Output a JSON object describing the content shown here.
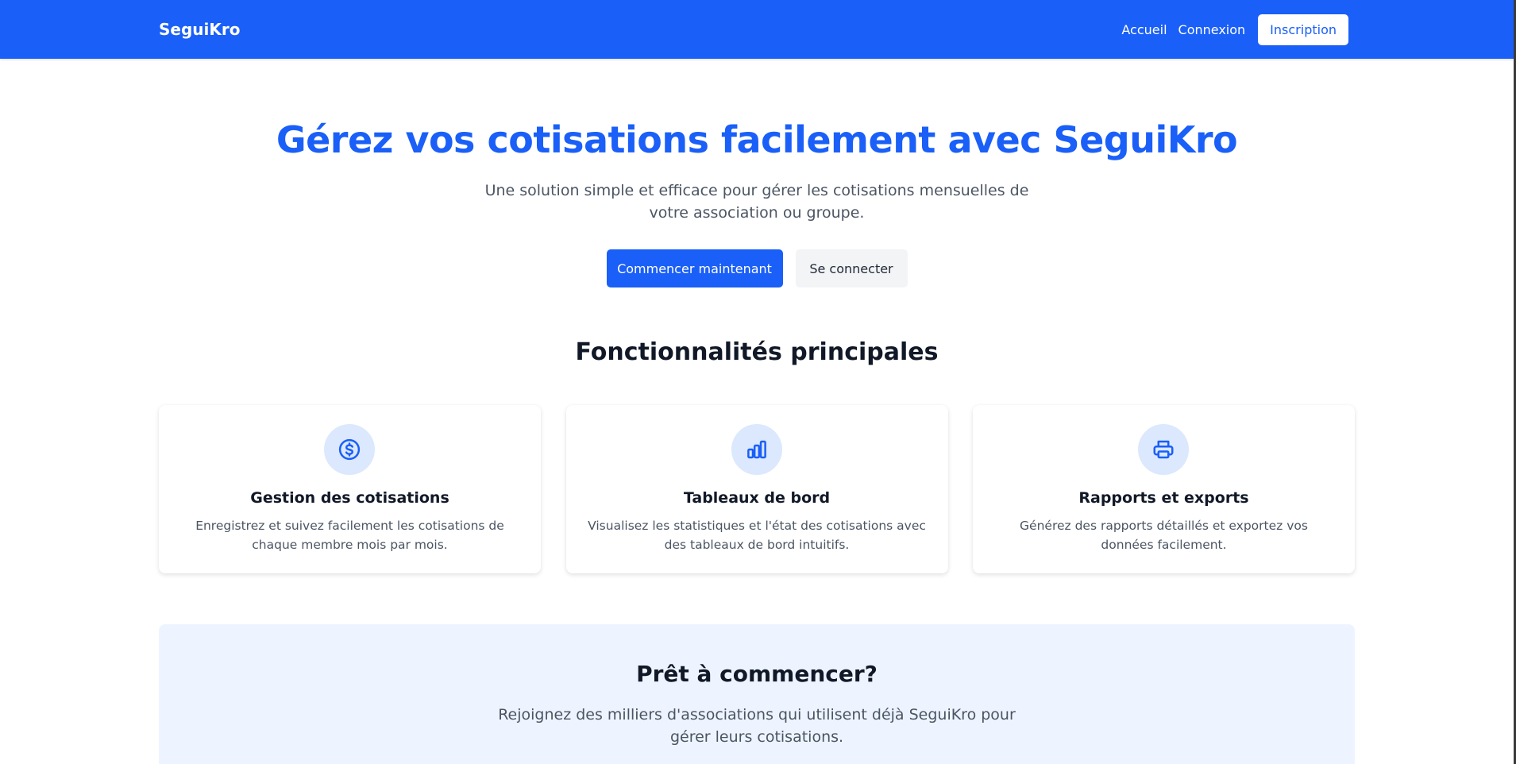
{
  "navbar": {
    "brand": "SeguiKro",
    "links": [
      "Accueil",
      "Connexion"
    ],
    "signup_label": "Inscription"
  },
  "hero": {
    "title": "Gérez vos cotisations facilement avec SeguiKro",
    "subtitle": "Une solution simple et efficace pour gérer les cotisations mensuelles de votre association ou groupe.",
    "primary_button": "Commencer maintenant",
    "secondary_button": "Se connecter"
  },
  "features": {
    "title": "Fonctionnalités principales",
    "items": [
      {
        "icon": "dollar-circle-icon",
        "title": "Gestion des cotisations",
        "description": "Enregistrez et suivez facilement les cotisations de chaque membre mois par mois."
      },
      {
        "icon": "bar-chart-icon",
        "title": "Tableaux de bord",
        "description": "Visualisez les statistiques et l'état des cotisations avec des tableaux de bord intuitifs."
      },
      {
        "icon": "printer-icon",
        "title": "Rapports et exports",
        "description": "Générez des rapports détaillés et exportez vos données facilement."
      }
    ]
  },
  "cta": {
    "title": "Prêt à commencer?",
    "subtitle": "Rejoignez des milliers d'associations qui utilisent déjà SeguiKro pour gérer leurs cotisations."
  },
  "colors": {
    "primary": "#1a5ff7",
    "icon_bg": "#dbe8fd",
    "cta_bg": "#eef4ff"
  }
}
